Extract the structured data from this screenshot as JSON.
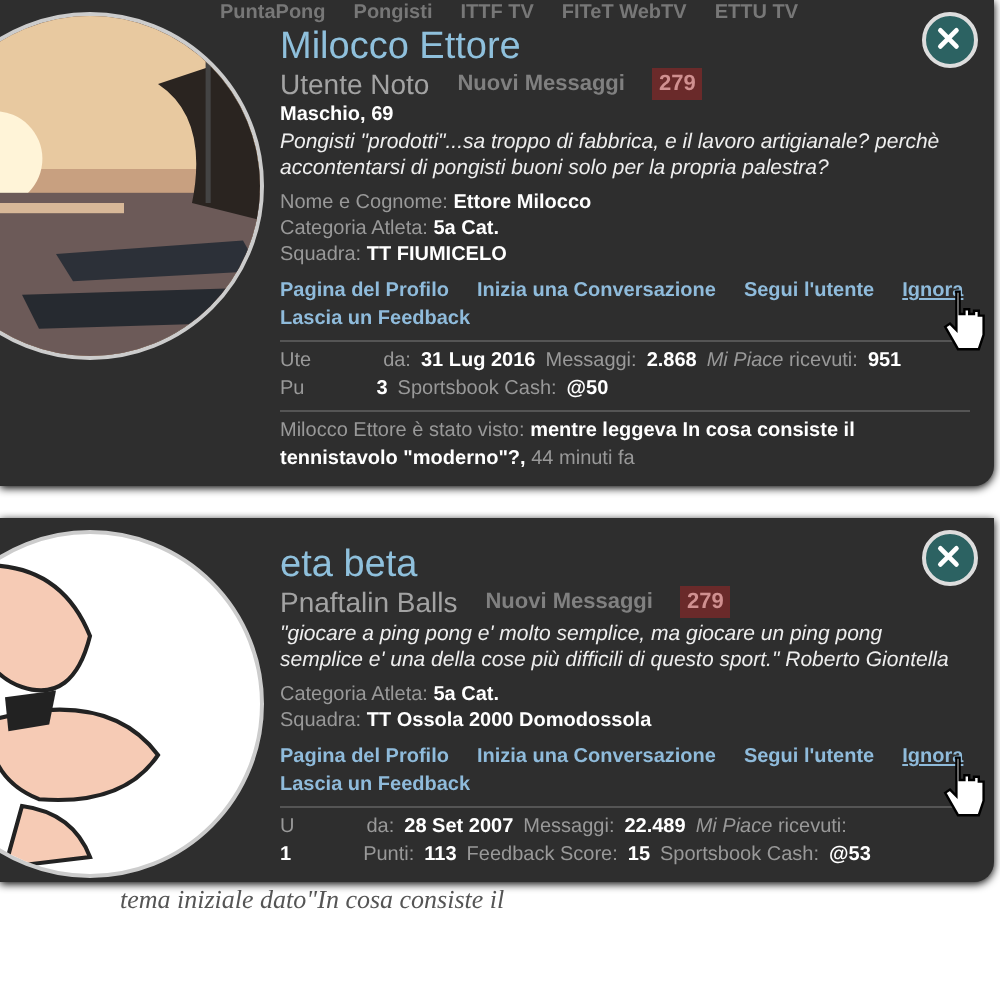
{
  "panels": [
    {
      "background": {
        "nav": [
          "PuntaPong",
          "Pongisti",
          "ITTF TV",
          "FITeT WebTV",
          "ETTU TV"
        ],
        "messages_label": "Nuovi Messaggi",
        "badge": "279"
      },
      "avatar": {
        "kind": "picture"
      },
      "name": "Milocco Ettore",
      "subtitle": "Utente Noto",
      "gender_age": "Maschio, 69",
      "quote": "Pongisti \"prodotti\"...sa troppo di fabbrica, e il lavoro artigianale? perchè accontentarsi di pongisti buoni solo per la propria palestra?",
      "fields": [
        {
          "label": "Nome e Cognome:",
          "value": "Ettore Milocco"
        },
        {
          "label": "Categoria Atleta:",
          "value": "5a Cat."
        },
        {
          "label": "Squadra:",
          "value": "TT FIUMICELO"
        }
      ],
      "links": [
        "Pagina del Profilo",
        "Inizia una Conversazione",
        "Segui l'utente",
        "Ignora",
        "Lascia un Feedback"
      ],
      "stats": [
        [
          {
            "label": "Ute"
          },
          {
            "label": "da:",
            "value": "31 Lug 2016"
          },
          {
            "label": "Messaggi:",
            "value": "2.868"
          },
          {
            "label": "*Mi Piace* ricevuti:",
            "value": "951"
          }
        ],
        [
          {
            "label": "Pu"
          },
          {
            "value": "3"
          },
          {
            "label": "Sportsbook Cash:",
            "value": "@50"
          }
        ]
      ],
      "seen": {
        "label": "Milocco Ettore è stato visto:",
        "text": "mentre leggeva In cosa consiste il tennistavolo \"moderno\"?,",
        "time": "44 minuti fa"
      }
    },
    {
      "background": {
        "messages_label": "Nuovi Messaggi",
        "badge": "279"
      },
      "avatar": {
        "kind": "drawing"
      },
      "name": "eta beta",
      "subtitle": "Pnaftalin Balls",
      "quote": "\"giocare a ping pong e' molto semplice, ma giocare un ping pong semplice e' una della cose più difficili di questo sport.\" Roberto Giontella",
      "fields": [
        {
          "label": "Categoria Atleta:",
          "value": "5a Cat."
        },
        {
          "label": "Squadra:",
          "value": "TT Ossola 2000 Domodossola"
        }
      ],
      "links": [
        "Pagina del Profilo",
        "Inizia una Conversazione",
        "Segui l'utente",
        "Ignora",
        "Lascia un Feedback"
      ],
      "stats": [
        [
          {
            "label": "U"
          },
          {
            "label": "da:",
            "value": "28 Set 2007"
          },
          {
            "label": "Messaggi:",
            "value": "22.489"
          },
          {
            "label": "*Mi Piace* ricevuti:"
          }
        ],
        [
          {
            "value": "1"
          },
          {
            "label": "Punti:",
            "value": "113"
          },
          {
            "label": "Feedback Score:",
            "value": "15"
          },
          {
            "label": "Sportsbook Cash:",
            "value": "@53"
          }
        ]
      ]
    }
  ],
  "page_text": "tema iniziale dato\"In cosa consiste il"
}
